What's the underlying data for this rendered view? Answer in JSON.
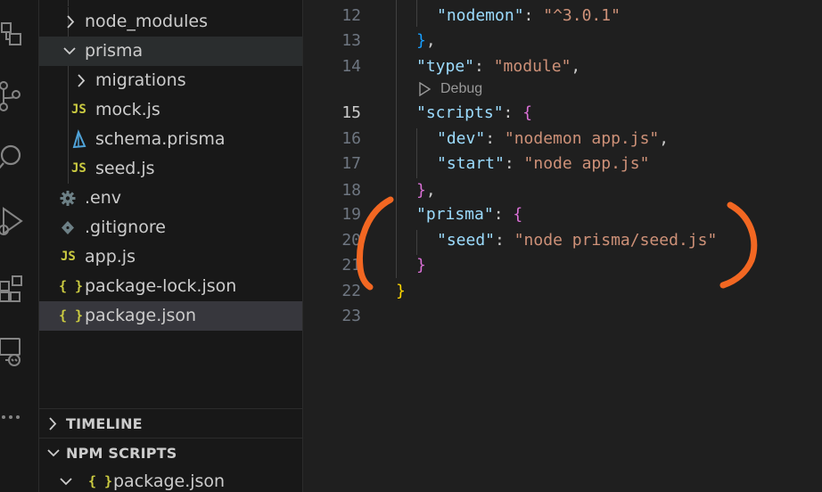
{
  "activity_bar": {
    "icons": [
      "explorer-icon",
      "source-control-icon",
      "search-icon",
      "run-debug-icon",
      "extensions-icon",
      "remote-explorer-icon",
      "more-icon"
    ]
  },
  "explorer": {
    "items": [
      {
        "label": "node_modules",
        "type": "folder-collapsed"
      },
      {
        "label": "prisma",
        "type": "folder-expanded"
      },
      {
        "label": "migrations",
        "type": "folder-collapsed"
      },
      {
        "label": "mock.js",
        "type": "js",
        "icon_text": "JS"
      },
      {
        "label": "schema.prisma",
        "type": "prisma"
      },
      {
        "label": "seed.js",
        "type": "js",
        "icon_text": "JS"
      },
      {
        "label": ".env",
        "type": "env"
      },
      {
        "label": ".gitignore",
        "type": "git"
      },
      {
        "label": "app.js",
        "type": "js",
        "icon_text": "JS"
      },
      {
        "label": "package-lock.json",
        "type": "json",
        "icon_text": "{ }"
      },
      {
        "label": "package.json",
        "type": "json",
        "icon_text": "{ }",
        "selected": true
      }
    ]
  },
  "panels": {
    "timeline": "TIMELINE",
    "npm_scripts": "NPM SCRIPTS",
    "npm_child": {
      "label": "package.json",
      "icon_text": "{ }"
    }
  },
  "editor": {
    "codelens": "Debug",
    "active_line": 15,
    "lines": [
      {
        "num": "12",
        "parts": [
          [
            "k",
            "\"nodemon\""
          ],
          [
            "p",
            ": "
          ],
          [
            "s",
            "\"^3.0.1\""
          ]
        ]
      },
      {
        "num": "13",
        "parts": [
          [
            "b3",
            "}"
          ],
          [
            "p",
            ","
          ]
        ]
      },
      {
        "num": "14",
        "parts": [
          [
            "k",
            "\"type\""
          ],
          [
            "p",
            ": "
          ],
          [
            "s",
            "\"module\""
          ],
          [
            "p",
            ","
          ]
        ]
      },
      {
        "num": "15",
        "parts": [
          [
            "k",
            "\"scripts\""
          ],
          [
            "p",
            ": "
          ],
          [
            "b2",
            "{"
          ]
        ]
      },
      {
        "num": "16",
        "parts": [
          [
            "k",
            "\"dev\""
          ],
          [
            "p",
            ": "
          ],
          [
            "s",
            "\"nodemon app.js\""
          ],
          [
            "p",
            ","
          ]
        ]
      },
      {
        "num": "17",
        "parts": [
          [
            "k",
            "\"start\""
          ],
          [
            "p",
            ": "
          ],
          [
            "s",
            "\"node app.js\""
          ]
        ]
      },
      {
        "num": "18",
        "parts": [
          [
            "b2",
            "}"
          ],
          [
            "p",
            ","
          ]
        ]
      },
      {
        "num": "19",
        "parts": [
          [
            "k",
            "\"prisma\""
          ],
          [
            "p",
            ": "
          ],
          [
            "b2",
            "{"
          ]
        ]
      },
      {
        "num": "20",
        "parts": [
          [
            "k",
            "\"seed\""
          ],
          [
            "p",
            ": "
          ],
          [
            "s",
            "\"node prisma/seed.js\""
          ]
        ]
      },
      {
        "num": "21",
        "parts": [
          [
            "b2",
            "}"
          ]
        ]
      },
      {
        "num": "22",
        "parts": [
          [
            "b1",
            "}"
          ]
        ]
      },
      {
        "num": "23",
        "parts": []
      }
    ]
  },
  "colors": {
    "annotation": "#f26722",
    "js_icon": "#cbcb41",
    "prisma_icon": "#4fa3d9",
    "env_icon": "#6d8086",
    "git_icon": "#41535b"
  }
}
